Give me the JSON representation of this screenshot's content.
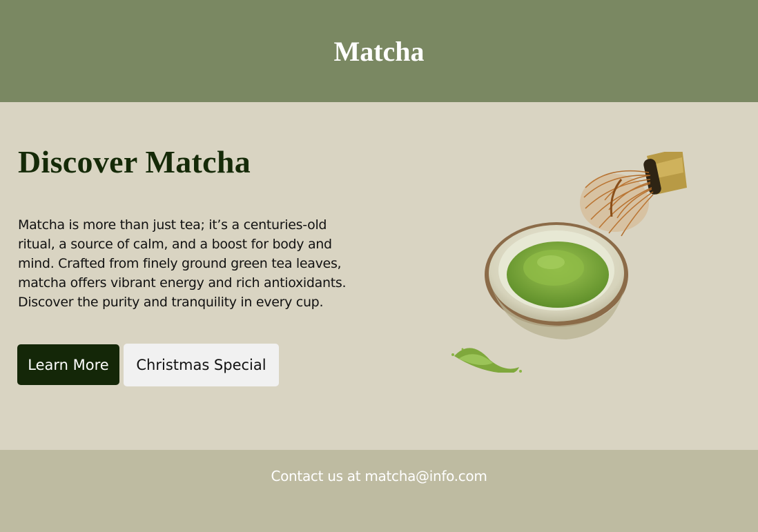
{
  "header": {
    "title": "Matcha"
  },
  "hero": {
    "heading": "Discover Matcha",
    "body": "Matcha is more than just tea; it’s a centuries-old ritual, a source of calm, and a boost for body and mind. Crafted from finely ground green tea leaves, matcha offers vibrant energy and rich antioxidants. Discover the purity and tranquility in every cup.",
    "primary_button": "Learn More",
    "secondary_button": "Christmas Special",
    "image_icon": "matcha-bowl-whisk-image"
  },
  "footer": {
    "contact": "Contact us at matcha@info.com"
  },
  "colors": {
    "header_bg": "#7a8862",
    "page_bg": "#d9d4c2",
    "footer_bg": "#bebba1",
    "heading_text": "#152a08",
    "primary_button_bg": "#142708",
    "secondary_button_bg": "#f1f1f1"
  }
}
